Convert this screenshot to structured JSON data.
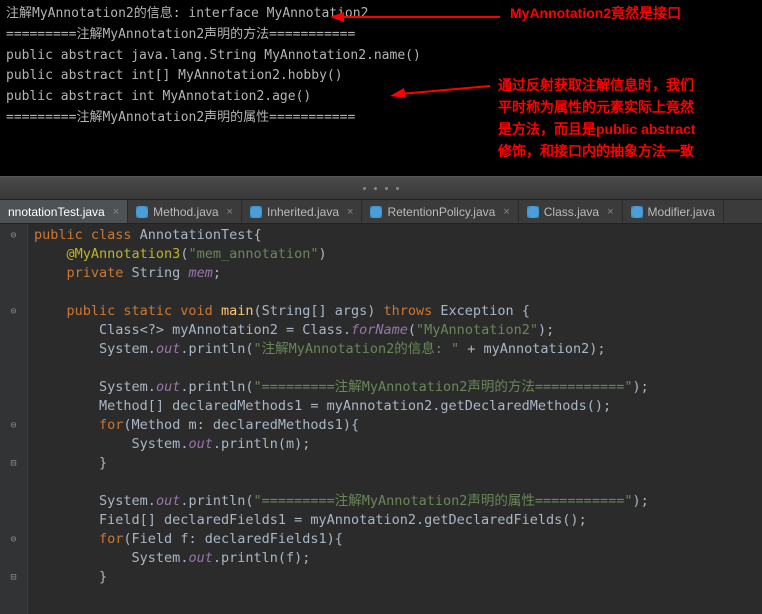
{
  "console": {
    "lines": [
      "注解MyAnnotation2的信息: interface MyAnnotation2",
      "=========注解MyAnnotation2声明的方法===========",
      "public abstract java.lang.String MyAnnotation2.name()",
      "public abstract int[] MyAnnotation2.hobby()",
      "public abstract int MyAnnotation2.age()",
      "=========注解MyAnnotation2声明的属性==========="
    ]
  },
  "callouts": {
    "top": "MyAnnotation2竟然是接口",
    "right1": "通过反射获取注解信息时，我们",
    "right2": "平时称为属性的元素实际上竟然",
    "right3": "是方法，而且是public abstract",
    "right4": "修饰，和接口内的抽象方法一致"
  },
  "tabs": [
    {
      "label": "nnotationTest.java",
      "active": true
    },
    {
      "label": "Method.java",
      "active": false
    },
    {
      "label": "Inherited.java",
      "active": false
    },
    {
      "label": "RetentionPolicy.java",
      "active": false
    },
    {
      "label": "Class.java",
      "active": false
    },
    {
      "label": "Modifier.java",
      "active": false
    }
  ],
  "code": {
    "class_decl_pre": "public class ",
    "class_name": "AnnotationTest",
    "anno": "@MyAnnotation3",
    "anno_arg": "\"mem_annotation\"",
    "priv": "private ",
    "stringT": "String ",
    "memF": "mem",
    "main_sig1": "public static void ",
    "main_name": "main",
    "main_args": "(String[] args) ",
    "throws": "throws ",
    "exc": "Exception {",
    "l1a": "Class<?> myAnnotation2 = Class.",
    "l1b": "forName",
    "l1c": "(",
    "l1s": "\"MyAnnotation2\"",
    "l1d": ");",
    "sysout_pre": "System.",
    "out": "out",
    "println": ".println(",
    "s2": "\"注解MyAnnotation2的信息: \"",
    "s2b": " + myAnnotation2);",
    "s3": "\"=========注解MyAnnotation2声明的方法===========\"",
    "s3b": ");",
    "l4": "Method[] declaredMethods1 = myAnnotation2.getDeclaredMethods();",
    "for": "for",
    "l5": "(Method m: declaredMethods1){",
    "l6_arg": "m",
    "l6_end": ");",
    "brace_close": "}",
    "s7": "\"=========注解MyAnnotation2声明的属性===========\"",
    "l8": "Field[] declaredFields1 = myAnnotation2.getDeclaredFields();",
    "l9": "(Field f: declaredFields1){",
    "l10_arg": "f"
  }
}
